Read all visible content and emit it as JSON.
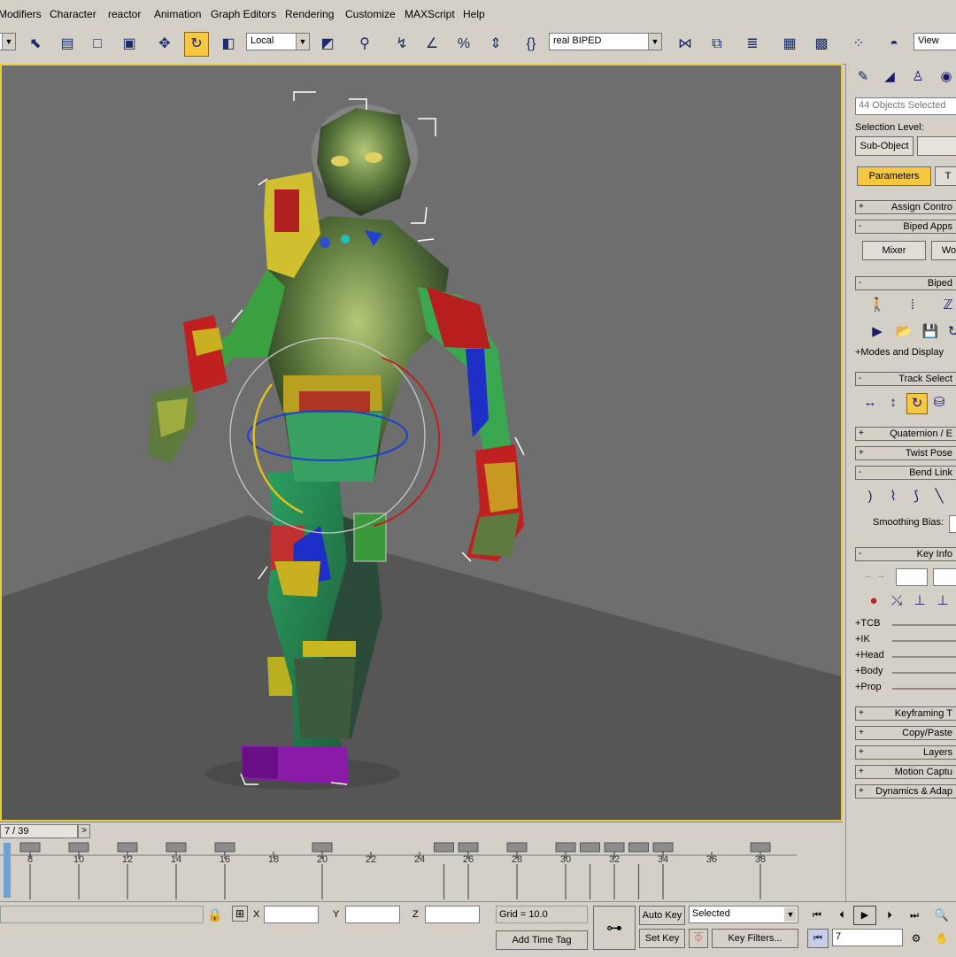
{
  "menubar": {
    "items": [
      "Modifiers",
      "Character",
      "reactor",
      "Animation",
      "Graph Editors",
      "Rendering",
      "Customize",
      "MAXScript",
      "Help"
    ]
  },
  "toolbar": {
    "coord_system": "Local",
    "named_selection": "real BIPED",
    "view_label": "View"
  },
  "command_panel": {
    "selection_info": "44 Objects Selected",
    "selection_level_label": "Selection Level:",
    "sub_object_button": "Sub-Object",
    "tab_parameters": "Parameters",
    "tab_t": "T",
    "rollouts": {
      "assign_controller": "Assign Contro",
      "biped_apps": "Biped Apps",
      "biped": "Biped",
      "track_selection": "Track Select",
      "quaternion": "Quaternion / E",
      "twist_poses": "Twist Pose",
      "bend_links": "Bend Link",
      "key_info": "Key Info",
      "keyframing_tools": "Keyframing T",
      "copy_paste": "Copy/Paste",
      "layers": "Layers",
      "motion_capture": "Motion Captu",
      "dynamics": "Dynamics & Adap"
    },
    "mixer_button": "Mixer",
    "workbench_button": "Wo",
    "modes_display": "+Modes and Display",
    "smoothing_bias_label": "Smoothing Bias:",
    "key_info_sublines": [
      "+TCB",
      "+IK",
      "+Head",
      "+Body",
      "+Prop"
    ],
    "sign_minus": "-",
    "sign_plus": "+"
  },
  "timeline": {
    "current_frame_display": "7 / 39",
    "next_arrow": ">",
    "ticks": [
      "8",
      "10",
      "12",
      "14",
      "16",
      "18",
      "20",
      "22",
      "24",
      "26",
      "28",
      "30",
      "32",
      "34",
      "36",
      "38"
    ]
  },
  "statusbar": {
    "x_label": "X",
    "y_label": "Y",
    "z_label": "Z",
    "grid": "Grid = 10.0",
    "add_time_tag": "Add Time Tag",
    "auto_key": "Auto Key",
    "selected_option": "Selected",
    "set_key": "Set Key",
    "key_filters": "Key Filters...",
    "frame_value": "7"
  },
  "colors": {
    "ui_gray": "#d4d0c8",
    "active_yellow": "#f7c742",
    "viewport_bg": "#6e6e6e",
    "viewport_border": "#e5cc3b",
    "autokey_red": "#c0302c"
  }
}
